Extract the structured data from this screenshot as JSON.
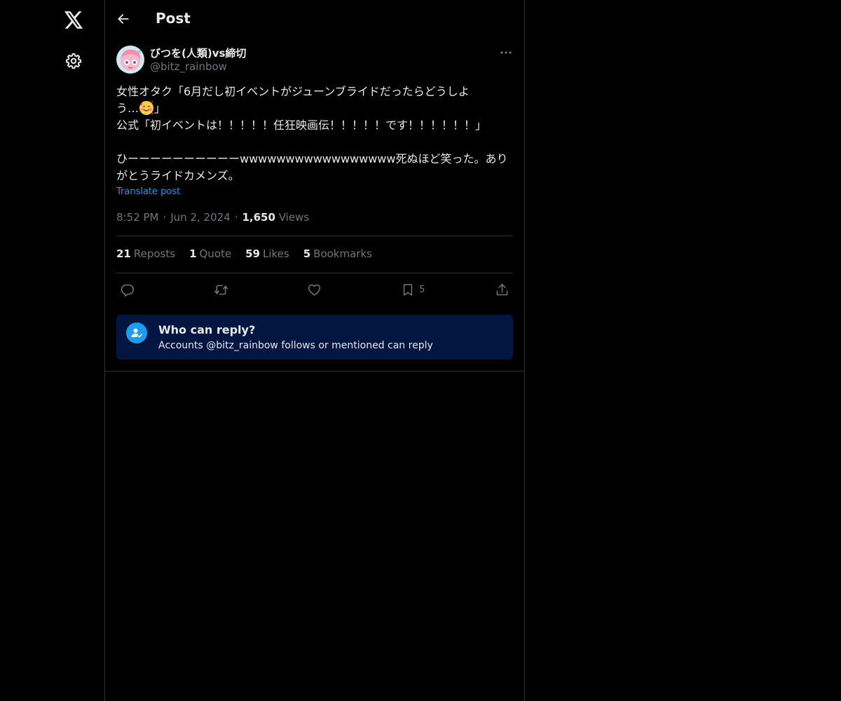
{
  "nav": {
    "logo_icon": "x-logo-icon",
    "settings_icon": "gear-icon"
  },
  "header": {
    "back_icon": "arrow-left-icon",
    "title": "Post"
  },
  "post": {
    "author": {
      "display_name": "びつを(人類)vs締切",
      "handle": "@bitz_rainbow",
      "avatar_icon": "avatar-illustration"
    },
    "more_icon": "ellipsis-icon",
    "text_lines": [
      "女性オタク「6月だし初イベントがジューンブライドだったらどうしよ",
      "う…",
      "」",
      "公式「初イベントは！！！！！任狂映画伝！！！！！です！！！！！！」",
      "",
      "ひーーーーーーーーーーwwwwwwwwwwwwwwwww死ぬほど笑った。あり",
      "がとうライドカメンズ。"
    ],
    "emoji": "smiling-face-with-hearts",
    "translate_label": "Translate post",
    "time": "8:52 PM",
    "date": "Jun 2, 2024",
    "views_count": "1,650",
    "views_label": "Views",
    "separator": "·",
    "stats": {
      "reposts_count": "21",
      "reposts_label": "Reposts",
      "quotes_count": "1",
      "quotes_label": "Quote",
      "likes_count": "59",
      "likes_label": "Likes",
      "bookmarks_count": "5",
      "bookmarks_label": "Bookmarks"
    },
    "actions": {
      "reply_icon": "reply-icon",
      "repost_icon": "repost-icon",
      "like_icon": "heart-icon",
      "bookmark_icon": "bookmark-icon",
      "bookmark_count": "5",
      "share_icon": "share-icon"
    },
    "reply_restriction": {
      "icon": "person-check-icon",
      "title": "Who can reply?",
      "description": "Accounts @bitz_rainbow follows or mentioned can reply"
    }
  },
  "colors": {
    "background": "#000000",
    "text_primary": "#e7e9ea",
    "text_secondary": "#71767b",
    "border": "#2f3336",
    "accent": "#1d9bf0",
    "reply_box_bg": "#031541"
  }
}
